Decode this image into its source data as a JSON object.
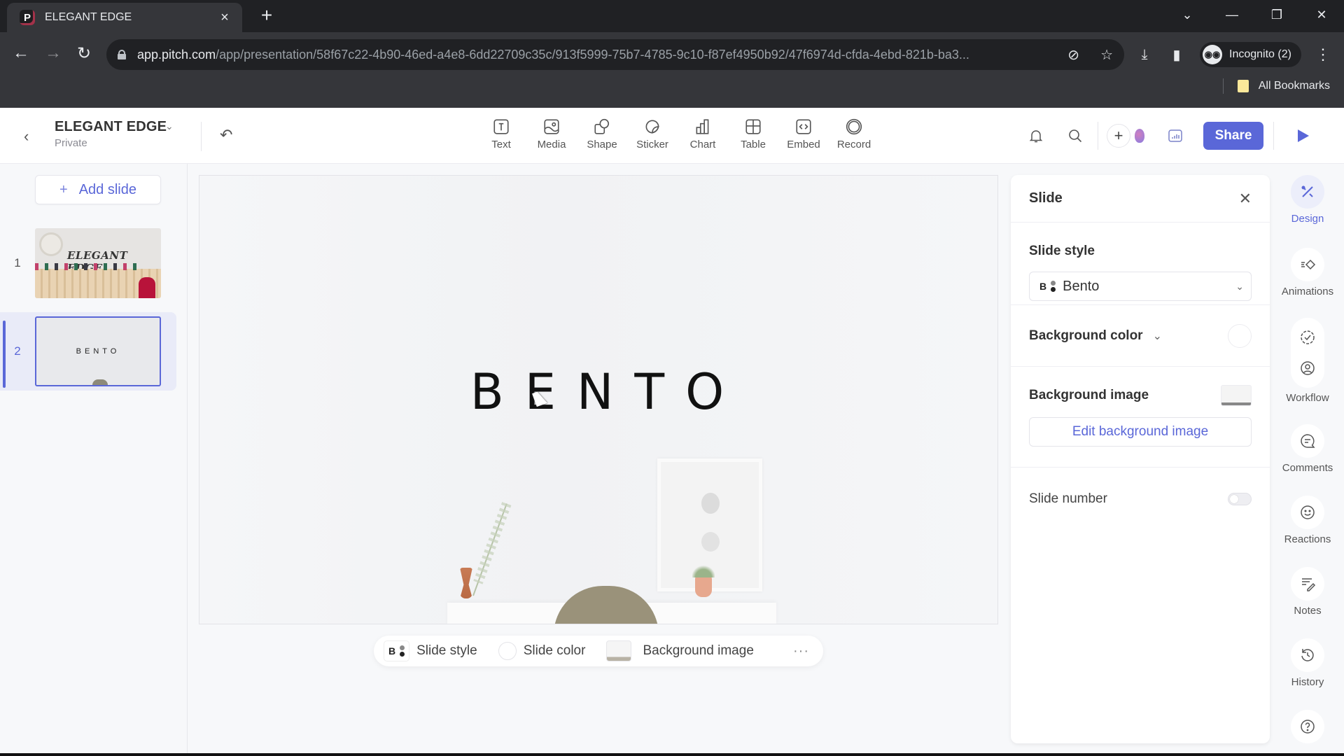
{
  "browser": {
    "tab_title": "ELEGANT EDGE",
    "tab_favicon": "P",
    "url_host": "app.pitch.com",
    "url_path": "/app/presentation/58f67c22-4b90-46ed-a4e8-6dd22709c35c/913f5999-75b7-4785-9c10-f87ef4950b92/47f6974d-cfda-4ebd-821b-ba3...",
    "profile_label": "Incognito (2)",
    "bookmarks_label": "All Bookmarks"
  },
  "header": {
    "doc_title": "ELEGANT EDGE",
    "doc_visibility": "Private",
    "insert_tools": [
      {
        "label": "Text",
        "icon": "text-icon"
      },
      {
        "label": "Media",
        "icon": "media-icon"
      },
      {
        "label": "Shape",
        "icon": "shape-icon"
      },
      {
        "label": "Sticker",
        "icon": "sticker-icon"
      },
      {
        "label": "Chart",
        "icon": "chart-icon"
      },
      {
        "label": "Table",
        "icon": "table-icon"
      },
      {
        "label": "Embed",
        "icon": "embed-icon"
      },
      {
        "label": "Record",
        "icon": "record-icon"
      }
    ],
    "share_label": "Share",
    "accent_color": "#5a67d8"
  },
  "sidebar": {
    "add_slide_label": "Add slide",
    "slides": [
      {
        "number": "1",
        "title": "ELEGANT EDGE",
        "selected": false
      },
      {
        "number": "2",
        "title": "BENTO",
        "selected": true
      }
    ]
  },
  "canvas": {
    "slide_title": "BENTO"
  },
  "bottom_bar": {
    "style_badge": "B",
    "slide_style_label": "Slide style",
    "slide_color_label": "Slide color",
    "background_image_label": "Background image",
    "more_label": "···"
  },
  "props": {
    "title": "Slide",
    "slide_style_heading": "Slide style",
    "slide_style_badge": "B",
    "slide_style_value": "Bento",
    "background_color_label": "Background color",
    "background_image_label": "Background image",
    "edit_background_label": "Edit background image",
    "slide_number_label": "Slide number",
    "slide_number_enabled": false
  },
  "rail": {
    "design": "Design",
    "animations": "Animations",
    "workflow": "Workflow",
    "comments": "Comments",
    "reactions": "Reactions",
    "notes": "Notes",
    "history": "History"
  }
}
